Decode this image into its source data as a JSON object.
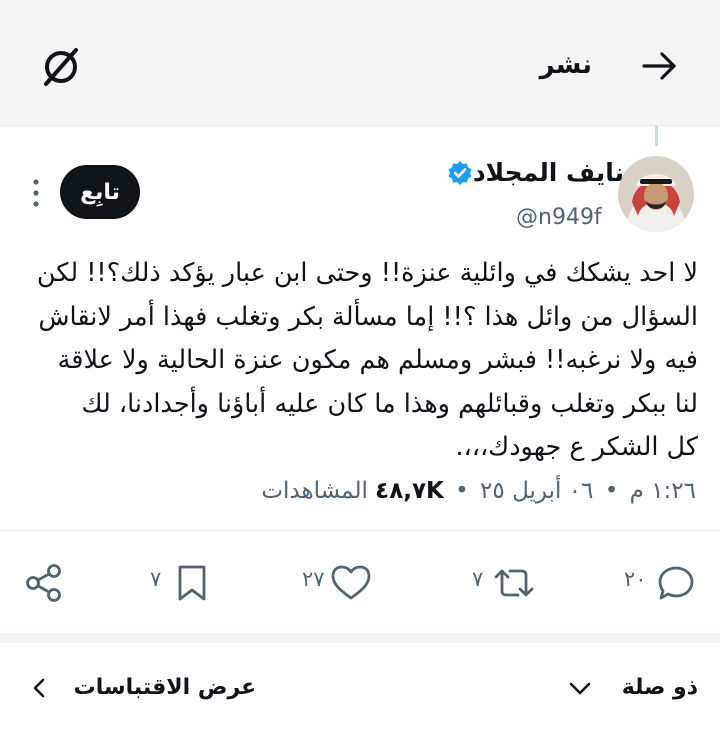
{
  "header": {
    "title": "نشر",
    "back_icon": "arrow-right-icon",
    "brand_icon": "grok-icon"
  },
  "author": {
    "display_name": "نايف المجلاد",
    "handle": "@n949f",
    "verified": true,
    "verified_color": "#1d9bf0"
  },
  "follow_button": {
    "label": "تابِع"
  },
  "tweet": {
    "lines": [
      "لا احد يشكك في وائلية عنزة!! وحتى ابن عبار يؤكد ذلك؟!! لكن",
      "السؤال من وائل هذا ؟!! إما مسألة بكر وتغلب فهذا أمر لانقاش",
      "فيه ولا نرغبه!! فبشر ومسلم هم مكون عنزة الحالية ولا علاقة",
      "لنا ببكر وتغلب وقبائلهم وهذا ما كان عليه أباؤنا وأجدادنا، لك",
      "كل الشكر ع جهودك،،،."
    ]
  },
  "meta": {
    "time": "١:٢٦ م",
    "date": "٠٦ أبريل ٢٥",
    "views_count": "٤٨,٧K",
    "views_label": "المشاهدات",
    "separator": "•"
  },
  "actions": {
    "reply_count": "٢٠",
    "repost_count": "٧",
    "like_count": "٢٧",
    "bookmark_count": "٧"
  },
  "footer": {
    "related_label": "ذو صلة",
    "quotes_label": "عرض الاقتباسات"
  },
  "colors": {
    "text": "#0f1419",
    "muted": "#536471",
    "topbar_bg": "#f5f5f5",
    "divider": "#eff3f4"
  }
}
